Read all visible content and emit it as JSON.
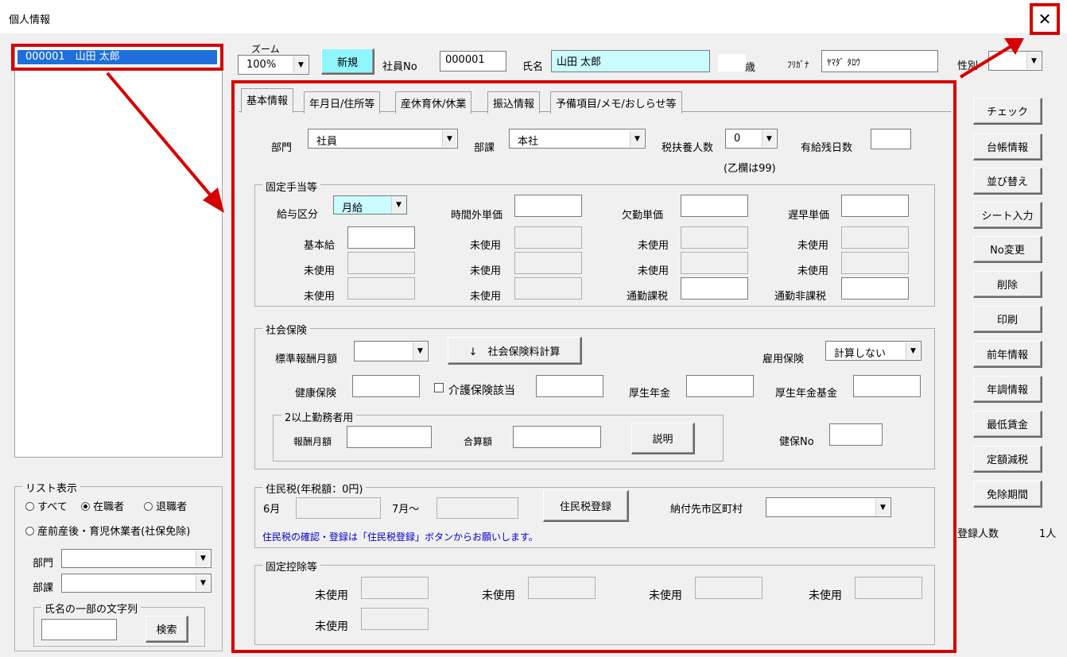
{
  "window": {
    "title": "個人情報",
    "close_label": "✕"
  },
  "list": {
    "selected_item": "000001　山田 太郎",
    "display_group": "リスト表示",
    "radio_all": "すべて",
    "radio_active": "在職者",
    "radio_retired": "退職者",
    "radio_leave": "産前産後・育児休業者(社保免除)",
    "dept_label": "部門",
    "section_label": "部課",
    "search_group": "氏名の一部の文字列",
    "search_button": "検索"
  },
  "header": {
    "zoom_label": "ズーム",
    "zoom_value": "100%",
    "new_button": "新規",
    "emp_no_label": "社員No",
    "emp_no_value": "000001",
    "name_label": "氏名",
    "name_value": "山田 太郎",
    "age_unit": "歳",
    "kana_label": "ﾌﾘｶﾞﾅ",
    "kana_value": "ﾔﾏﾀﾞ ﾀﾛｳ",
    "gender_label": "性別"
  },
  "tabs": [
    "基本情報",
    "年月日/住所等",
    "産休育休/休業",
    "振込情報",
    "予備項目/メモ/おしらせ等"
  ],
  "basic": {
    "dept_label": "部門",
    "dept_value": "社員",
    "section_label": "部課",
    "section_value": "本社",
    "dependents_label": "税扶養人数",
    "dependents_value": "0",
    "dependents_note": "(乙欄は99)",
    "paid_leave_label": "有給残日数"
  },
  "allowance": {
    "legend": "固定手当等",
    "pay_type_label": "給与区分",
    "pay_type_value": "月給",
    "overtime_label": "時間外単価",
    "absence_label": "欠勤単価",
    "late_label": "遅早単価",
    "base_label": "基本給",
    "unused": "未使用",
    "commute_tax_label": "通勤課税",
    "commute_free_label": "通勤非課税"
  },
  "social": {
    "legend": "社会保険",
    "std_pay_label": "標準報酬月額",
    "calc_button": "↓　社会保険料計算",
    "employment_label": "雇用保険",
    "employment_value": "計算しない",
    "health_label": "健康保険",
    "care_label": "介護保険該当",
    "pension_label": "厚生年金",
    "pension_fund_label": "厚生年金基金",
    "multi_legend": "2以上勤務者用",
    "monthly_label": "報酬月額",
    "total_label": "合算額",
    "explain_button": "説明",
    "health_no_label": "健保No"
  },
  "resident": {
    "legend": "住民税(年税額：0円)",
    "june_label": "6月",
    "july_label": "7月～",
    "register_button": "住民税登録",
    "city_label": "納付先市区町村",
    "note": "住民税の確認・登録は「住民税登録」ボタンからお願いします。"
  },
  "deduction": {
    "legend": "固定控除等",
    "unused": "未使用"
  },
  "side_buttons": [
    "チェック",
    "台帳情報",
    "並び替え",
    "シート入力",
    "No変更",
    "削除",
    "印刷",
    "前年情報",
    "年調情報",
    "最低賃金",
    "定額減税",
    "免除期間"
  ],
  "footer": {
    "count_label": "登録人数",
    "count_value": "1人"
  },
  "colors": {
    "highlight_red": "#d60000",
    "selection_blue": "#1e6fd9",
    "cyan_field": "#c9fbff",
    "note_blue": "#0000cc"
  }
}
